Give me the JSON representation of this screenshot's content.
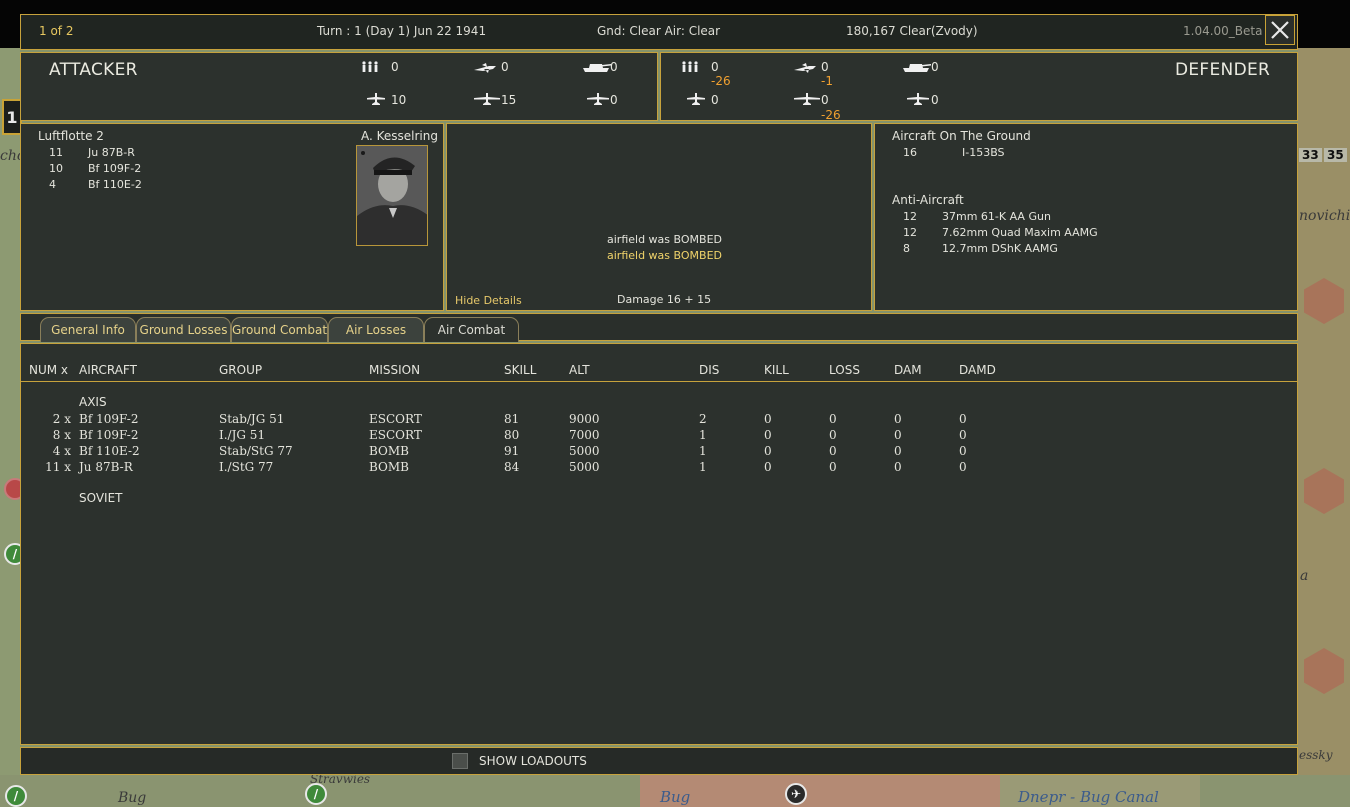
{
  "map": {
    "hex_numbers": [
      "33",
      "35"
    ],
    "labels": [
      "cho",
      "novichi",
      "a",
      "essky",
      "Stravwies",
      "Bug",
      "Bug",
      "Dnepr - Bug Canal"
    ],
    "left_button": "1"
  },
  "header": {
    "page": "1 of 2",
    "turn": "Turn : 1 (Day 1)   Jun 22 1941",
    "weather": "Gnd: Clear  Air: Clear",
    "location": "180,167   Clear(Zvody)",
    "version": "1.04.00_Beta"
  },
  "attacker": {
    "title": "ATTACKER",
    "men": "0",
    "fighter_bomber": "0",
    "tanks": "0",
    "bombers": "10",
    "fighters": "15",
    "recon": "0"
  },
  "defender": {
    "title": "DEFENDER",
    "men": "0",
    "men_loss": "-26",
    "fighter_bomber": "0",
    "fighter_bomber_loss": "-1",
    "tanks": "0",
    "bombers": "0",
    "fighters": "0",
    "fighters_loss": "-26",
    "recon": "0"
  },
  "attacker_detail": {
    "unit": "Luftflotte 2",
    "leader": "A. Kesselring",
    "aircraft": [
      {
        "count": "11",
        "name": "Ju 87B-R"
      },
      {
        "count": "10",
        "name": "Bf 109F-2"
      },
      {
        "count": "4",
        "name": "Bf 110E-2"
      }
    ]
  },
  "result": {
    "lines": [
      "airfield was BOMBED",
      "airfield was BOMBED"
    ],
    "hide_details": "Hide Details",
    "damage": "Damage  16 + 15"
  },
  "defender_detail": {
    "ground_title": "Aircraft On The Ground",
    "ground": [
      {
        "count": "16",
        "name": "I-153BS"
      }
    ],
    "aa_title": "Anti-Aircraft",
    "aa": [
      {
        "count": "12",
        "name": "37mm 61-K AA Gun"
      },
      {
        "count": "12",
        "name": "7.62mm Quad Maxim AAMG"
      },
      {
        "count": "8",
        "name": "12.7mm DShK AAMG"
      }
    ]
  },
  "tabs": [
    "General Info",
    "Ground Losses",
    "Ground Combat",
    "Air Losses",
    "Air Combat"
  ],
  "table": {
    "headers": [
      "NUM x",
      "AIRCRAFT",
      "GROUP",
      "MISSION",
      "SKILL",
      "ALT",
      "DIS",
      "KILL",
      "LOSS",
      "DAM",
      "DAMD"
    ],
    "axis_label": "AXIS",
    "soviet_label": "SOVIET",
    "rows": [
      {
        "num": "2 x",
        "aircraft": "Bf 109F-2",
        "group": "Stab/JG 51",
        "mission": "ESCORT",
        "skill": "81",
        "alt": "9000",
        "dis": "2",
        "kill": "0",
        "loss": "0",
        "dam": "0",
        "damd": "0"
      },
      {
        "num": "8 x",
        "aircraft": "Bf 109F-2",
        "group": "I./JG 51",
        "mission": "ESCORT",
        "skill": "80",
        "alt": "7000",
        "dis": "1",
        "kill": "0",
        "loss": "0",
        "dam": "0",
        "damd": "0"
      },
      {
        "num": "4 x",
        "aircraft": "Bf 110E-2",
        "group": "Stab/StG 77",
        "mission": "BOMB",
        "skill": "91",
        "alt": "5000",
        "dis": "1",
        "kill": "0",
        "loss": "0",
        "dam": "0",
        "damd": "0"
      },
      {
        "num": "11 x",
        "aircraft": "Ju 87B-R",
        "group": "I./StG 77",
        "mission": "BOMB",
        "skill": "84",
        "alt": "5000",
        "dis": "1",
        "kill": "0",
        "loss": "0",
        "dam": "0",
        "damd": "0"
      }
    ]
  },
  "footer": {
    "show_loadouts": "SHOW LOADOUTS"
  }
}
